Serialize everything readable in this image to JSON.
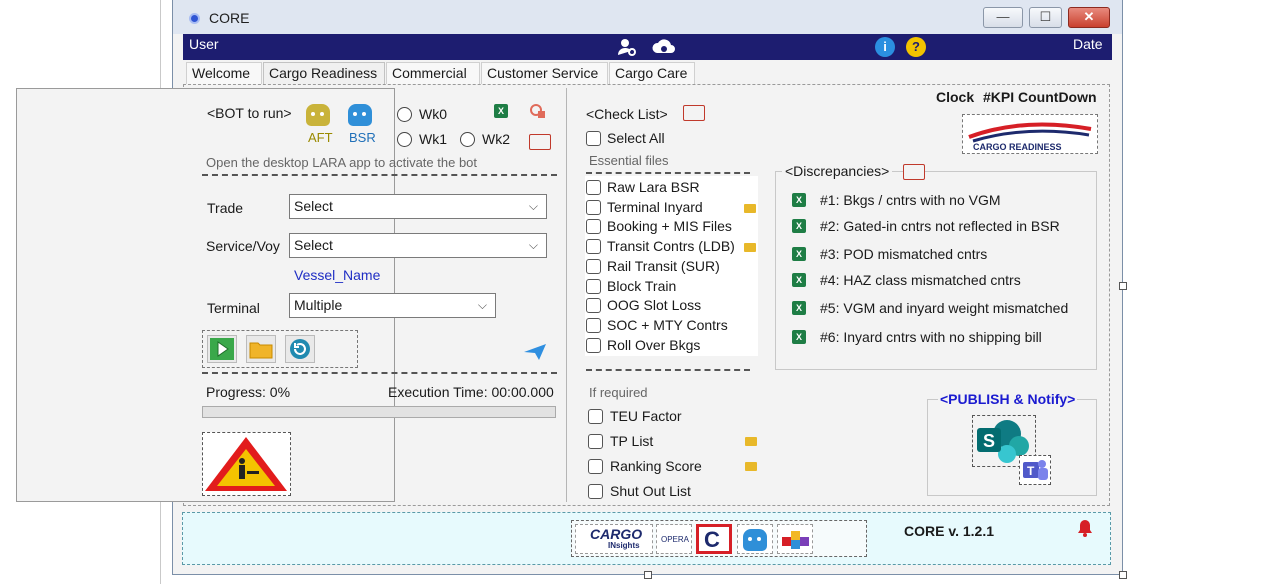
{
  "window": {
    "title": "CORE"
  },
  "userbar": {
    "user_label": "User",
    "date_label": "Date"
  },
  "tabs": [
    {
      "label": "Welcome"
    },
    {
      "label": "Cargo Readiness"
    },
    {
      "label": "Commercial"
    },
    {
      "label": "Customer Service"
    },
    {
      "label": "Cargo Care"
    }
  ],
  "bot": {
    "heading": "<BOT to run>",
    "bots": [
      {
        "label": "AFT",
        "color": "#c9b33a"
      },
      {
        "label": "BSR",
        "color": "#2f8fd8"
      }
    ],
    "weeks": [
      "Wk0",
      "Wk1",
      "Wk2"
    ],
    "hint": "Open the desktop LARA app to activate the bot"
  },
  "form": {
    "trade_label": "Trade",
    "trade_value": "Select",
    "service_label": "Service/Voy",
    "service_value": "Select",
    "vessel_name": "Vessel_Name",
    "terminal_label": "Terminal",
    "terminal_value": "Multiple"
  },
  "progress": {
    "label": "Progress: 0%",
    "value_percent": 0,
    "execution_time": "Execution Time: 00:00.000"
  },
  "checklist": {
    "heading": "<Check List>",
    "select_all": "Select All",
    "essential_heading": "Essential files",
    "essential": [
      "Raw Lara BSR",
      "Terminal Inyard",
      "Booking + MIS Files",
      "Transit Contrs (LDB)",
      "Rail Transit (SUR)",
      "Block Train",
      "OOG Slot Loss",
      "SOC + MTY Contrs",
      "Roll Over Bkgs"
    ],
    "required_heading": "If required",
    "required": [
      "TEU Factor",
      "TP List",
      "Ranking Score",
      "Shut Out List"
    ]
  },
  "header_right": {
    "clock": "Clock",
    "kpi": "#KPI CountDown",
    "logo_text": "CARGO READINESS"
  },
  "discrepancies": {
    "heading": "<Discrepancies>",
    "items": [
      "#1: Bkgs / cntrs with no VGM",
      "#2: Gated-in cntrs not reflected in BSR",
      "#3: POD mismatched cntrs",
      "#4: HAZ class mismatched cntrs",
      "#5: VGM and inyard weight mismatched",
      "#6: Inyard cntrs with no shipping bill"
    ]
  },
  "publish": {
    "heading": "<PUBLISH & Notify>"
  },
  "footer": {
    "version": "CORE  v. 1.2.1",
    "logos": [
      "CARGO",
      "INsights",
      "OPERA",
      "C"
    ]
  },
  "colors": {
    "accent_navy": "#1d1d70",
    "excel_green": "#1e7d45",
    "publish_blue": "#1a1ad0"
  }
}
